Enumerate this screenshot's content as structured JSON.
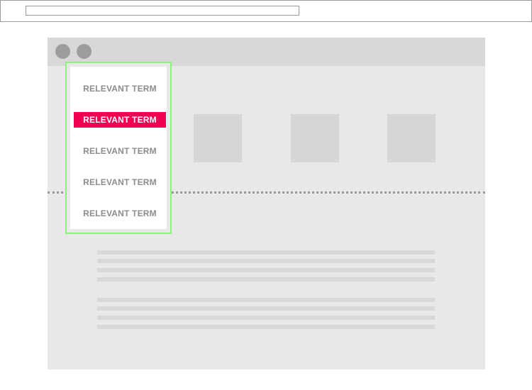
{
  "colors": {
    "highlight_border": "#8ef07f",
    "active_term_bg": "#f0004e",
    "window_bg": "#e8e8e8",
    "title_bar": "#d8d8d8"
  },
  "search": {
    "value": ""
  },
  "suggestions": {
    "items": [
      {
        "label": "RELEVANT TERM",
        "active": false
      },
      {
        "label": "RELEVANT TERM",
        "active": true
      },
      {
        "label": "RELEVANT TERM",
        "active": false
      },
      {
        "label": "RELEVANT TERM",
        "active": false
      },
      {
        "label": "RELEVANT TERM",
        "active": false
      }
    ]
  }
}
